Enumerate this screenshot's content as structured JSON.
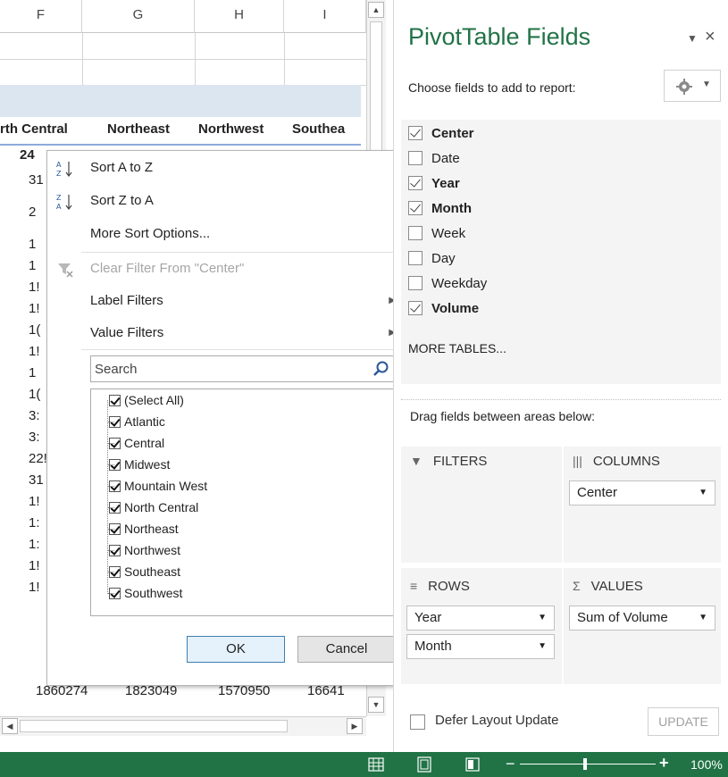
{
  "sheet": {
    "columns": [
      "F",
      "G",
      "H",
      "I"
    ],
    "headers": [
      "rth Central",
      "Northeast",
      "Northwest",
      "Southea"
    ],
    "first_value": "24",
    "partial_left": [
      "31",
      "2",
      "1",
      "1",
      "1!",
      "1!",
      "1(",
      "1!",
      "1",
      "1(",
      "3:",
      "3:",
      "22!",
      "31",
      "1!",
      "1:",
      "1:",
      "1!",
      "1!"
    ],
    "bottom_row": [
      "1860274",
      "1823049",
      "1570950",
      "16641"
    ]
  },
  "filter_menu": {
    "sort_az": "Sort A to Z",
    "sort_za": "Sort Z to A",
    "more_sort": "More Sort Options...",
    "clear_filter": "Clear Filter From \"Center\"",
    "label_filters": "Label Filters",
    "value_filters": "Value Filters",
    "search_placeholder": "Search",
    "items": [
      "(Select All)",
      "Atlantic",
      "Central",
      "Midwest",
      "Mountain West",
      "North Central",
      "Northeast",
      "Northwest",
      "Southeast",
      "Southwest"
    ],
    "ok": "OK",
    "cancel": "Cancel"
  },
  "pane": {
    "title": "PivotTable Fields",
    "choose_label": "Choose fields to add to report:",
    "fields": [
      {
        "name": "Center",
        "checked": true
      },
      {
        "name": "Date",
        "checked": false
      },
      {
        "name": "Year",
        "checked": true
      },
      {
        "name": "Month",
        "checked": true
      },
      {
        "name": "Week",
        "checked": false
      },
      {
        "name": "Day",
        "checked": false
      },
      {
        "name": "Weekday",
        "checked": false
      },
      {
        "name": "Volume",
        "checked": true
      }
    ],
    "more_tables": "MORE TABLES...",
    "drag_label": "Drag fields between areas below:",
    "areas": {
      "filters": "FILTERS",
      "columns": "COLUMNS",
      "rows": "ROWS",
      "values": "VALUES"
    },
    "columns_items": [
      "Center"
    ],
    "rows_items": [
      "Year",
      "Month"
    ],
    "values_items": [
      "Sum of Volume"
    ],
    "defer_label": "Defer Layout Update",
    "update_label": "UPDATE"
  },
  "status": {
    "zoom": "100%"
  },
  "colors": {
    "excel_green": "#217346",
    "pivot_band": "#dce6f1"
  }
}
